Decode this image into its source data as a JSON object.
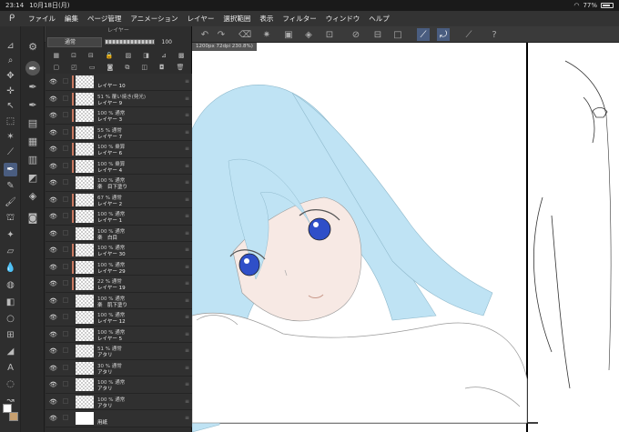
{
  "status": {
    "time": "23:14",
    "date": "10月18日(月)",
    "battery": "77%"
  },
  "menu": [
    "ファイル",
    "編集",
    "ページ管理",
    "アニメーション",
    "レイヤー",
    "選択範囲",
    "表示",
    "フィルター",
    "ウィンドウ",
    "ヘルプ"
  ],
  "layer_panel": {
    "title": "レイヤー",
    "blend_mode": "通常",
    "opacity": "100"
  },
  "canvas": {
    "tab_label": "1200px 72dpi 230.8%)"
  },
  "layers": [
    {
      "mode": "",
      "name": "レイヤー 10",
      "clip": true
    },
    {
      "mode": "51 % 覆い焼き(発光)",
      "name": "レイヤー 9",
      "clip": true
    },
    {
      "mode": "100 % 通常",
      "name": "レイヤー 3",
      "clip": true
    },
    {
      "mode": "55 % 通常",
      "name": "レイヤー 7",
      "clip": true
    },
    {
      "mode": "100 % 乗算",
      "name": "レイヤー 6",
      "clip": true
    },
    {
      "mode": "100 % 乗算",
      "name": "レイヤー 4",
      "clip": true
    },
    {
      "mode": "100 % 通常",
      "name": "楽　目下塗り",
      "clip": false
    },
    {
      "mode": "67 % 通常",
      "name": "レイヤー 2",
      "clip": true
    },
    {
      "mode": "100 % 通常",
      "name": "レイヤー 1",
      "clip": true
    },
    {
      "mode": "100 % 通常",
      "name": "楽　白目",
      "clip": false
    },
    {
      "mode": "100 % 通常",
      "name": "レイヤー 30",
      "clip": true
    },
    {
      "mode": "100 % 通常",
      "name": "レイヤー 29",
      "clip": true
    },
    {
      "mode": "22 % 通常",
      "name": "レイヤー 19",
      "clip": true
    },
    {
      "mode": "100 % 通常",
      "name": "楽　肌下塗り",
      "clip": false
    },
    {
      "mode": "100 % 通常",
      "name": "レイヤー 12",
      "clip": false
    },
    {
      "mode": "100 % 通常",
      "name": "レイヤー 5",
      "clip": false
    },
    {
      "mode": "51 % 通常",
      "name": "アタリ",
      "clip": false
    },
    {
      "mode": "30 % 通常",
      "name": "アタリ",
      "clip": false
    },
    {
      "mode": "100 % 通常",
      "name": "アタリ",
      "clip": false
    },
    {
      "mode": "100 % 通常",
      "name": "アタリ",
      "clip": false
    },
    {
      "mode": "",
      "name": "用紙",
      "clip": false
    }
  ],
  "colors": {
    "hair": "#bfe3f4",
    "eye": "#2f4fc8",
    "skin": "#f7e9e4",
    "selected": "#4a5d80"
  }
}
